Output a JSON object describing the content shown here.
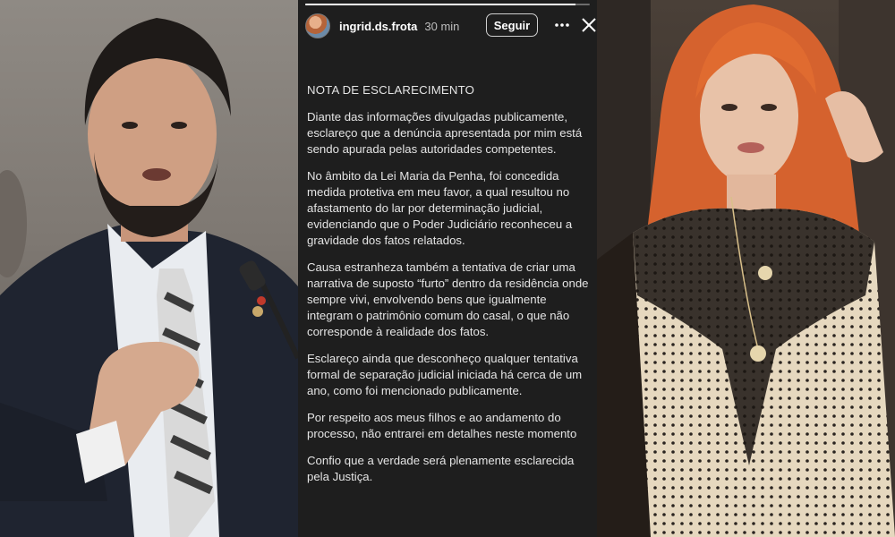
{
  "story": {
    "progress": 0.95,
    "header": {
      "avatar_icon": "profile-avatar",
      "username": "ingrid.ds.frota",
      "timestamp": "30 min",
      "follow_label": "Seguir",
      "more_icon": "more-options-icon",
      "close_icon": "close-icon"
    },
    "title": "NOTA DE ESCLARECIMENTO",
    "paragraphs": [
      "Diante das informações divulgadas publicamente, esclareço que a denúncia apresentada por mim está sendo apurada pelas autoridades competentes.",
      "No âmbito da Lei Maria da Penha, foi concedida medida protetiva em meu favor, a qual resultou no afastamento do lar por determinação judicial, evidenciando que o Poder Judiciário reconheceu a gravidade dos fatos relatados.",
      "Causa estranheza também a tentativa de criar uma narrativa de suposto “furto” dentro da residência onde sempre vivi, envolvendo bens que igualmente integram o patrimônio comum do casal, o que não corresponde à realidade dos fatos.",
      "Esclareço ainda que desconheço qualquer tentativa formal de separação judicial iniciada há cerca de um ano, como foi mencionado publicamente.",
      "Por respeito aos meus filhos e ao andamento do processo, não entrarei em detalhes neste momento",
      "Confio que a verdade será plenamente esclarecida pela Justiça."
    ]
  },
  "photos": {
    "left": "photo-man-speaking-at-microphone",
    "right": "photo-red-haired-woman-lace-dress"
  },
  "colors": {
    "story_bg": "#1e1e1e",
    "story_text": "#e4e4e4"
  }
}
